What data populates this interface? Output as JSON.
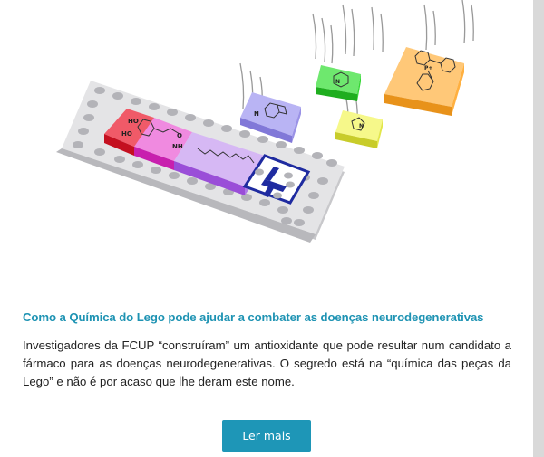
{
  "article": {
    "headline": "Como a Química do Lego pode ajudar a combater as doenças neurodegenerativas",
    "body": "Investigadores da FCUP “construíram” um antioxidante que pode resultar num candidato a fármaco para as doenças neurodegenerativas. O segredo está na “química das peças da Lego” e não é por acaso que lhe deram este nome.",
    "read_more_label": "Ler mais"
  },
  "illustration": {
    "labels": {
      "ho_top": "HO",
      "ho_bottom": "HO",
      "oxygen": "O",
      "nh": "NH",
      "n_purple": "N",
      "n_green": "N",
      "n_yellow": "N",
      "p_plus": "P+"
    },
    "colors": {
      "board": "#e4e4e6",
      "red": "#e8192c",
      "pink": "#e040c8",
      "violet": "#b07ae8",
      "purple_block": "#a9a2ee",
      "green_block": "#33d633",
      "yellow_block": "#ecf25a",
      "orange_block": "#ffb040",
      "navy": "#1f2ba0"
    }
  }
}
